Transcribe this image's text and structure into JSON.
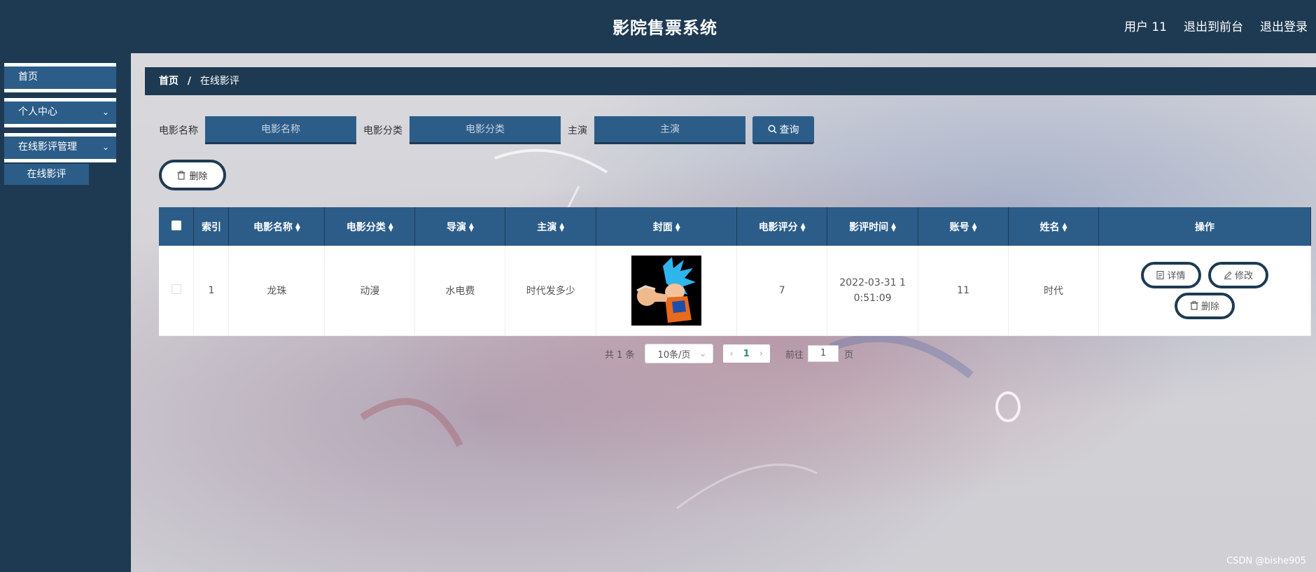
{
  "app": {
    "title": "影院售票系统"
  },
  "topbar": {
    "user": "用户 11",
    "to_front": "退出到前台",
    "logout": "退出登录"
  },
  "sidebar": {
    "items": [
      {
        "label": "首页"
      },
      {
        "label": "个人中心"
      },
      {
        "label": "在线影评管理"
      }
    ],
    "sub_items": [
      {
        "label": "在线影评"
      }
    ]
  },
  "breadcrumb": {
    "home": "首页",
    "sep": "/",
    "current": "在线影评"
  },
  "search": {
    "movie_name_label": "电影名称",
    "movie_name_placeholder": "电影名称",
    "category_label": "电影分类",
    "category_placeholder": "电影分类",
    "actor_label": "主演",
    "actor_placeholder": "主演",
    "query_label": "查询"
  },
  "actions": {
    "delete_label": "删除"
  },
  "table": {
    "columns": [
      "索引",
      "电影名称",
      "电影分类",
      "导演",
      "主演",
      "封面",
      "电影评分",
      "影评时间",
      "账号",
      "姓名",
      "操作"
    ],
    "rows": [
      {
        "index": "1",
        "movie_name": "龙珠",
        "category": "动漫",
        "director": "水电费",
        "actor": "时代发多少",
        "score": "7",
        "time": "2022-03-31 10:51:09",
        "account": "11",
        "name": "时代"
      }
    ],
    "op_detail": "详情",
    "op_edit": "修改",
    "op_delete": "删除"
  },
  "pager": {
    "total": "共 1 条",
    "page_size": "10条/页",
    "current_page": "1",
    "goto_label": "前往",
    "goto_value": "1",
    "page_suffix": "页"
  },
  "watermark": "CSDN @bishe905",
  "colors": {
    "header_bg": "#1e3a52",
    "accent": "#2c5d89"
  }
}
